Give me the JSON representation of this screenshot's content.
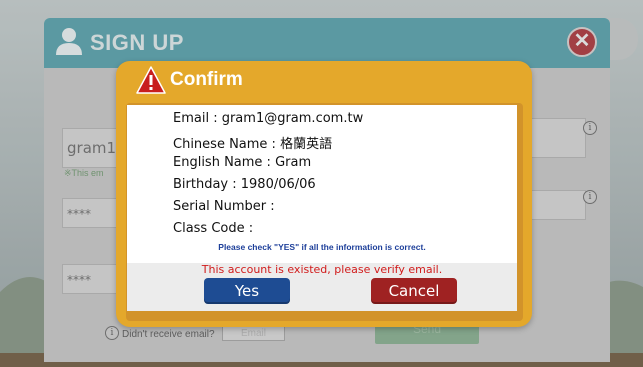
{
  "signup": {
    "title": "SIGN UP",
    "username_value": "gram1",
    "note": "※This em",
    "password_mask": "****",
    "confirm_password_mask": "****",
    "no_email_text": "Didn't receive email?",
    "email_button": "Email",
    "send_button": "Send",
    "close_icon": "close-icon",
    "user_icon": "user-icon"
  },
  "confirm": {
    "title": "Confirm",
    "warning_icon": "warning-icon",
    "lines": [
      "Email : gram1@gram.com.tw",
      "Chinese Name : 格蘭英語",
      "English Name : Gram",
      "Birthday : 1980/06/06",
      "Serial Number :",
      "Class Code :"
    ],
    "check_message": "Please check \"YES\" if all the information is correct.",
    "error_message": "This account is existed, please verify email.",
    "yes_label": "Yes",
    "cancel_label": "Cancel"
  },
  "colors": {
    "dialog_orange": "#e4a82b",
    "yes_blue": "#1e4c93",
    "cancel_red": "#9f2222",
    "error_red": "#d11b1b",
    "message_blue": "#1d3f9a"
  }
}
